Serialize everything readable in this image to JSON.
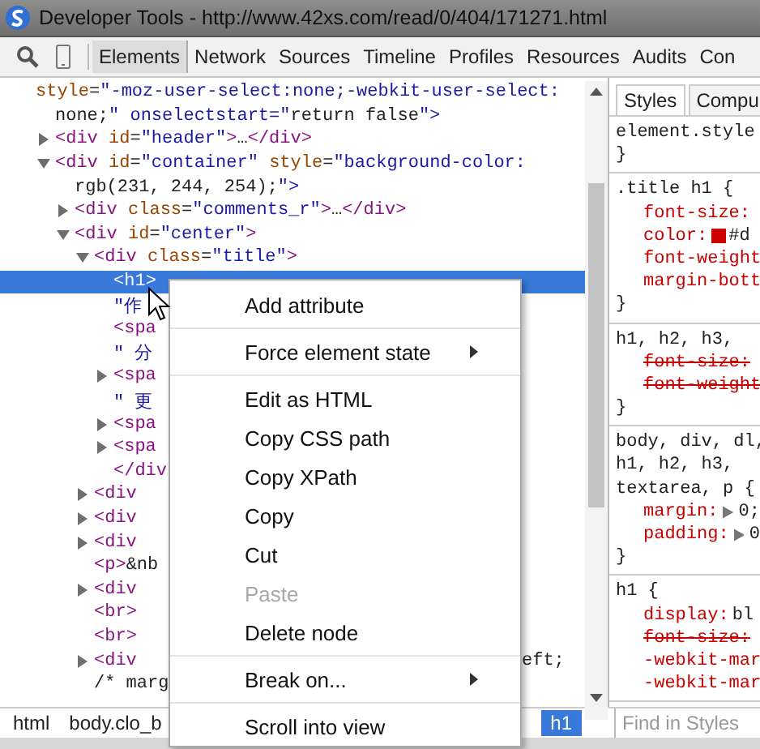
{
  "window": {
    "title": "Developer Tools - http://www.42xs.com/read/0/404/171271.html"
  },
  "tabs": [
    {
      "label": "Elements",
      "selected": true
    },
    {
      "label": "Network",
      "selected": false
    },
    {
      "label": "Sources",
      "selected": false
    },
    {
      "label": "Timeline",
      "selected": false
    },
    {
      "label": "Profiles",
      "selected": false
    },
    {
      "label": "Resources",
      "selected": false
    },
    {
      "label": "Audits",
      "selected": false
    },
    {
      "label": "Con",
      "selected": false
    }
  ],
  "dom_tree": [
    {
      "lines": [
        "style=\"-moz-user-select:none;-webkit-user-select:",
        "none;\" onselectstart=\"return false\">"
      ],
      "selected": false,
      "children": [
        {
          "lines": [
            "<div id=\"header\">…</div>"
          ],
          "expanded": false,
          "selected": false
        },
        {
          "lines": [
            "<div id=\"container\" style=\"background-color:",
            "rgb(231, 244, 254);\">"
          ],
          "expanded": true,
          "selected": false,
          "children": [
            {
              "lines": [
                "<div class=\"comments_r\">…</div>"
              ],
              "expanded": false,
              "selected": false
            },
            {
              "lines": [
                "<div id=\"center\">"
              ],
              "expanded": true,
              "selected": false,
              "children": [
                {
                  "lines": [
                    "<div class=\"title\">"
                  ],
                  "expanded": true,
                  "selected": false,
                  "children": [
                    {
                      "lines": [
                        "<h1>"
                      ],
                      "selected": true
                    },
                    {
                      "lines": [
                        "\"作"
                      ],
                      "selected": false
                    },
                    {
                      "lines": [
                        "<spa"
                      ],
                      "selected": false
                    },
                    {
                      "lines": [
                        "\" 分"
                      ],
                      "selected": false
                    },
                    {
                      "lines": [
                        "<spa"
                      ],
                      "expanded": false,
                      "selected": false
                    },
                    {
                      "lines": [
                        "\" 更"
                      ],
                      "selected": false
                    },
                    {
                      "lines": [
                        "<spa"
                      ],
                      "expanded": false,
                      "selected": false
                    },
                    {
                      "lines": [
                        "<spa"
                      ],
                      "expanded": false,
                      "selected": false
                    },
                    {
                      "lines": [
                        "</div"
                      ],
                      "selected": false
                    }
                  ]
                },
                {
                  "lines": [
                    "<div"
                  ],
                  "expanded": false,
                  "selected": false
                },
                {
                  "lines": [
                    "<div"
                  ],
                  "expanded": false,
                  "selected": false
                },
                {
                  "lines": [
                    "<div"
                  ],
                  "expanded": false,
                  "selected": false
                },
                {
                  "lines": [
                    "<p>&nb"
                  ],
                  "selected": false
                },
                {
                  "lines": [
                    "<div"
                  ],
                  "expanded": false,
                  "selected": false
                },
                {
                  "lines": [
                    "<br>"
                  ],
                  "selected": false
                },
                {
                  "lines": [
                    "<br>"
                  ],
                  "selected": false
                },
                {
                  "lines": [
                    "<div"
                  ],
                  "expanded": false,
                  "selected": false,
                  "tail": "eft;"
                },
                {
                  "lines": [
                    "/* marg"
                  ],
                  "selected": false
                }
              ]
            }
          ]
        }
      ]
    }
  ],
  "breadcrumbs": [
    {
      "label": "html",
      "selected": false
    },
    {
      "label": "body.clo_b",
      "selected": false
    },
    {
      "label": "h1",
      "selected": true
    }
  ],
  "styles_tabs": [
    {
      "label": "Styles",
      "selected": true
    },
    {
      "label": "Compu",
      "selected": false
    }
  ],
  "rules": [
    {
      "selector": [
        "element.style"
      ],
      "closing": "}"
    },
    {
      "selector": [
        ".title h1 {"
      ],
      "props": [
        {
          "name": "font-size:",
          "struck": false
        },
        {
          "name": "color:",
          "value": "#d",
          "color": "#cc0000",
          "struck": false
        },
        {
          "name": "font-weight",
          "struck": false
        },
        {
          "name": "margin-bott",
          "struck": false
        }
      ],
      "closing": "}"
    },
    {
      "selector": [
        "h1, h2, h3,"
      ],
      "props": [
        {
          "name": "font-size:",
          "struck": true
        },
        {
          "name": "font-weight",
          "struck": true
        }
      ],
      "closing": "}"
    },
    {
      "selector": [
        "body, div, dl,",
        "h1, h2, h3,",
        "textarea, p {"
      ],
      "props": [
        {
          "name": "margin:",
          "value": "0;",
          "expander": true,
          "struck": false
        },
        {
          "name": "padding:",
          "value": "0",
          "expander": true,
          "struck": false
        }
      ],
      "closing": "}"
    },
    {
      "selector": [
        "h1 {"
      ],
      "props": [
        {
          "name": "display:",
          "value": "bl",
          "struck": false
        },
        {
          "name": "font-size:",
          "struck": true
        },
        {
          "name": "-webkit-mar",
          "struck": false
        },
        {
          "name": "-webkit-mar",
          "struck": false
        }
      ]
    }
  ],
  "find_styles": {
    "placeholder": "Find in Styles"
  },
  "context_menu": [
    {
      "kind": "item",
      "label": "Add attribute",
      "disabled": false
    },
    {
      "kind": "separator"
    },
    {
      "kind": "item",
      "label": "Force element state",
      "disabled": false,
      "submenu": true
    },
    {
      "kind": "separator"
    },
    {
      "kind": "item",
      "label": "Edit as HTML",
      "disabled": false
    },
    {
      "kind": "item",
      "label": "Copy CSS path",
      "disabled": false
    },
    {
      "kind": "item",
      "label": "Copy XPath",
      "disabled": false
    },
    {
      "kind": "item",
      "label": "Copy",
      "disabled": false
    },
    {
      "kind": "item",
      "label": "Cut",
      "disabled": false
    },
    {
      "kind": "item",
      "label": "Paste",
      "disabled": true
    },
    {
      "kind": "item",
      "label": "Delete node",
      "disabled": false
    },
    {
      "kind": "separator"
    },
    {
      "kind": "item",
      "label": "Break on...",
      "disabled": false,
      "submenu": true
    },
    {
      "kind": "separator"
    },
    {
      "kind": "item",
      "label": "Scroll into view",
      "disabled": false
    }
  ]
}
